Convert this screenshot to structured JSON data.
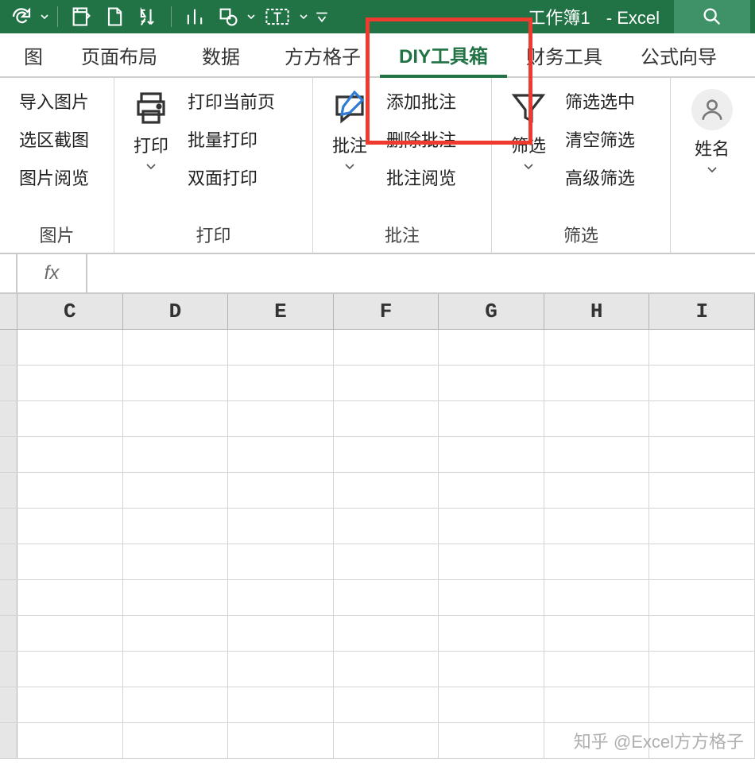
{
  "title": {
    "workbook": "工作簿1",
    "app": "- Excel"
  },
  "tabs": [
    "图",
    "页面布局",
    "数据",
    "方方格子",
    "DIY工具箱",
    "财务工具",
    "公式向导"
  ],
  "groups": {
    "picture": {
      "label": "图片",
      "items": [
        "导入图片",
        "选区截图",
        "图片阅览"
      ]
    },
    "print": {
      "label": "打印",
      "big": "打印",
      "items": [
        "打印当前页",
        "批量打印",
        "双面打印"
      ]
    },
    "comment": {
      "label": "批注",
      "big": "批注",
      "items": [
        "添加批注",
        "删除批注",
        "批注阅览"
      ]
    },
    "filter": {
      "label": "筛选",
      "big": "筛选",
      "items": [
        "筛选选中",
        "清空筛选",
        "高级筛选"
      ]
    },
    "name": {
      "big": "姓名"
    }
  },
  "formula_bar": {
    "fx": "fx",
    "value": ""
  },
  "columns": [
    "C",
    "D",
    "E",
    "F",
    "G",
    "H",
    "I"
  ],
  "row_count": 12,
  "watermark": "知乎 @Excel方方格子"
}
